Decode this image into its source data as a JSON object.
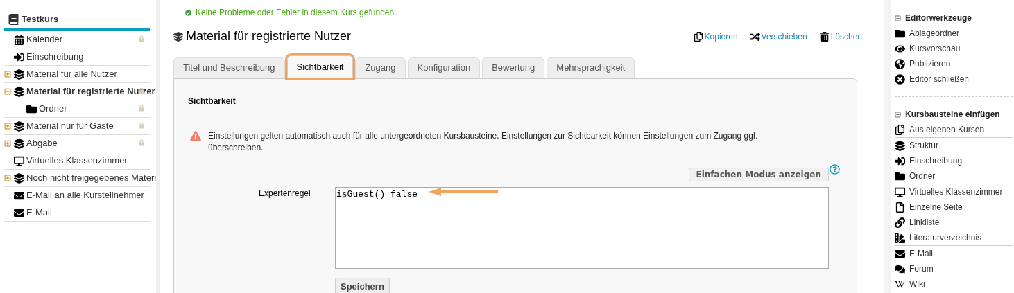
{
  "course_tree": {
    "title": "Testkurs",
    "items": [
      {
        "kind": "calendar",
        "label": "Kalender",
        "locked": true,
        "selected": false
      },
      {
        "kind": "enrollment",
        "label": "Einschreibung",
        "locked": false,
        "selected": false
      },
      {
        "kind": "structure",
        "label": "Material für alle Nutzer",
        "locked": false,
        "selected": false,
        "expanded": false
      },
      {
        "kind": "structure",
        "label": "Material für registrierte Nutzer",
        "locked": true,
        "selected": true,
        "expanded": true,
        "children": [
          {
            "kind": "folder",
            "label": "Ordner",
            "locked": true,
            "selected": false
          }
        ]
      },
      {
        "kind": "structure",
        "label": "Material nur für Gäste",
        "locked": true,
        "selected": false,
        "expanded": false
      },
      {
        "kind": "structure",
        "label": "Abgabe",
        "locked": true,
        "selected": false,
        "expanded": false
      },
      {
        "kind": "classroom",
        "label": "Virtuelles Klassenzimmer",
        "locked": false,
        "selected": false
      },
      {
        "kind": "structure",
        "label": "Noch nicht freigegebenes Materi",
        "locked": false,
        "selected": false,
        "expanded": false
      },
      {
        "kind": "mail",
        "label": "E-Mail an alle Kursteilnehmer",
        "locked": false,
        "selected": false
      },
      {
        "kind": "mail",
        "label": "E-Mail",
        "locked": false,
        "selected": false
      }
    ]
  },
  "status_message": "Keine Probleme oder Fehler in diesem Kurs gefunden.",
  "node_title": "Material für registrierte Nutzer",
  "actions": [
    {
      "kind": "copy",
      "label": "Kopieren"
    },
    {
      "kind": "move",
      "label": "Verschieben"
    },
    {
      "kind": "delete",
      "label": "Löschen"
    }
  ],
  "tabs": [
    {
      "label": "Titel und Beschreibung",
      "selected": false,
      "highlighted": false
    },
    {
      "label": "Sichtbarkeit",
      "selected": true,
      "highlighted": true
    },
    {
      "label": "Zugang",
      "selected": false,
      "highlighted": false
    },
    {
      "label": "Konfiguration",
      "selected": false,
      "highlighted": false
    },
    {
      "label": "Bewertung",
      "selected": false,
      "highlighted": false
    },
    {
      "label": "Mehrsprachigkeit",
      "selected": false,
      "highlighted": false
    }
  ],
  "panel": {
    "heading": "Sichtbarkeit",
    "warning": "Einstellungen gelten automatisch auch für alle untergeordneten Kursbausteine. Einstellungen zur Sichtbarkeit können Einstellungen zum Zugang ggf. überschreiben.",
    "mode_button": "Einfachen Modus anzeigen",
    "rule_label": "Expertenregel",
    "rule_value": "isGuest()=false",
    "rule_annotated": true,
    "save_button": "Speichern"
  },
  "sidebar": {
    "sections": [
      {
        "title": "Editorwerkzeuge",
        "expanded": true,
        "groups": [
          [
            {
              "kind": "folder",
              "label": "Ablageordner"
            },
            {
              "kind": "eye",
              "label": "Kursvorschau"
            },
            {
              "kind": "publish",
              "label": "Publizieren"
            },
            {
              "kind": "close",
              "label": "Editor schließen"
            }
          ]
        ]
      },
      {
        "title": "Kursbausteine einfügen",
        "expanded": true,
        "groups": [
          [
            {
              "kind": "copy",
              "label": "Aus eigenen Kursen"
            }
          ],
          [
            {
              "kind": "structure",
              "label": "Struktur"
            },
            {
              "kind": "enrollment",
              "label": "Einschreibung"
            },
            {
              "kind": "folder",
              "label": "Ordner"
            }
          ],
          [
            {
              "kind": "classroom",
              "label": "Virtuelles Klassenzimmer"
            },
            {
              "kind": "page",
              "label": "Einzelne Seite"
            },
            {
              "kind": "link",
              "label": "Linkliste"
            },
            {
              "kind": "library",
              "label": "Literaturverzeichnis"
            }
          ],
          [
            {
              "kind": "mail",
              "label": "E-Mail"
            },
            {
              "kind": "forum",
              "label": "Forum"
            },
            {
              "kind": "wiki",
              "label": "Wiki"
            }
          ]
        ]
      }
    ]
  }
}
